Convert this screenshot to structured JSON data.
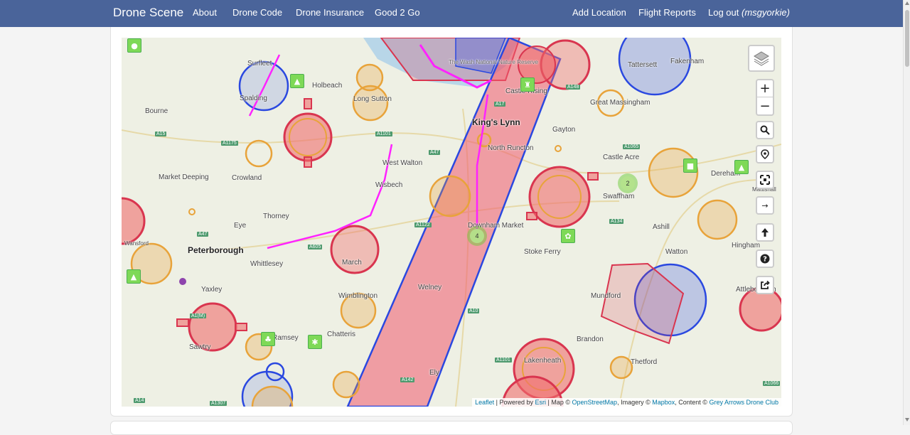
{
  "navbar": {
    "brand": "Drone Scene",
    "links_left": [
      "About",
      "Drone Code",
      "Drone Insurance",
      "Good 2 Go"
    ],
    "links_right": [
      "Add Location",
      "Flight Reports"
    ],
    "logout_label": "Log out",
    "username": "(msgyorkie)",
    "bg_color": "#4a649a"
  },
  "map": {
    "places": [
      {
        "name": "Holbeach"
      },
      {
        "name": "Surfleet"
      },
      {
        "name": "Spalding"
      },
      {
        "name": "Bourne"
      },
      {
        "name": "Long Sutton"
      },
      {
        "name": "Market Deeping"
      },
      {
        "name": "Crowland"
      },
      {
        "name": "West Walton"
      },
      {
        "name": "Wisbech"
      },
      {
        "name": "Thorney"
      },
      {
        "name": "Eye"
      },
      {
        "name": "Peterborough"
      },
      {
        "name": "Whittlesey"
      },
      {
        "name": "March"
      },
      {
        "name": "Yaxley"
      },
      {
        "name": "Wimblington"
      },
      {
        "name": "Chatteris"
      },
      {
        "name": "Sawtry"
      },
      {
        "name": "Ely"
      },
      {
        "name": "Welney"
      },
      {
        "name": "King's Lynn"
      },
      {
        "name": "North Runcton"
      },
      {
        "name": "Gayton"
      },
      {
        "name": "Castle Rising"
      },
      {
        "name": "Great Massingham"
      },
      {
        "name": "Castle Acre"
      },
      {
        "name": "Swaffham"
      },
      {
        "name": "Downham Market"
      },
      {
        "name": "Stoke Ferry"
      },
      {
        "name": "Ashill"
      },
      {
        "name": "Watton"
      },
      {
        "name": "Mundford"
      },
      {
        "name": "Brandon"
      },
      {
        "name": "Lakenheath"
      },
      {
        "name": "Thetford"
      },
      {
        "name": "Tattersett"
      },
      {
        "name": "Fakenham"
      },
      {
        "name": "Dereham"
      },
      {
        "name": "Hingham"
      },
      {
        "name": "Attleborough"
      },
      {
        "name": "Mattishall"
      },
      {
        "name": "The Wash National Nature Reserve"
      },
      {
        "name": "Ramsey"
      },
      {
        "name": "Wansford"
      }
    ],
    "roads": [
      "A15",
      "A1175",
      "A1101",
      "A47",
      "A17",
      "A148",
      "A1065",
      "A10",
      "A1122",
      "A134",
      "A142",
      "A1101",
      "A14",
      "A1307",
      "A605",
      "A1(M)",
      "A1066",
      "A47"
    ],
    "clusters": [
      "2",
      "4"
    ],
    "controls": {
      "layers": "layers-control",
      "zoom_in": "+",
      "zoom_out": "−"
    },
    "attribution": {
      "leaflet": "Leaflet",
      "powered_by": "| Powered by",
      "esri": "Esri",
      "map_prefix": "| Map ©",
      "osm": "OpenStreetMap",
      "imagery_prefix": ", Imagery ©",
      "mapbox": "Mapbox",
      "content_prefix": ", Content ©",
      "club": "Grey Arrows Drone Club"
    }
  },
  "colors": {
    "red_zone": "#d9354f",
    "orange_zone": "#e8a33a",
    "blue_zone": "#2a48e0",
    "magenta_route": "#ff22ff",
    "marker_green": "#7ed957"
  }
}
